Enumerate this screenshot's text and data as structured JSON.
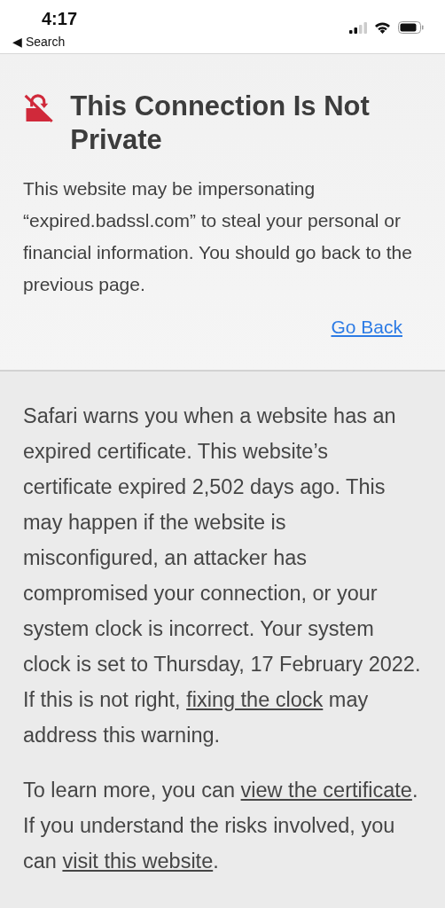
{
  "status_bar": {
    "time": "4:17",
    "back_label": "◀ Search"
  },
  "warning": {
    "title": "This Connection Is Not Private",
    "message": "This website may be impersonating “expired.badssl.com” to steal your personal or financial information. You should go back to the previous page.",
    "go_back": "Go Back"
  },
  "details": [
    {
      "segments": [
        {
          "kind": "text",
          "text": "Safari warns you when a website has an expired certificate. This website’s certificate expired 2,502 days ago. This may happen if the website is misconfigured, an attacker has compromised your connection, or your system clock is incorrect. Your system clock is set to Thursday, 17 February 2022. If this is not right, "
        },
        {
          "kind": "link",
          "text": "fixing the clock"
        },
        {
          "kind": "text",
          "text": " may address this warning."
        }
      ]
    },
    {
      "segments": [
        {
          "kind": "text",
          "text": "To learn more, you can "
        },
        {
          "kind": "link",
          "text": "view the certificate"
        },
        {
          "kind": "text",
          "text": ". If you understand the risks involved, you can "
        },
        {
          "kind": "link",
          "text": "visit this website"
        },
        {
          "kind": "text",
          "text": "."
        }
      ]
    }
  ]
}
